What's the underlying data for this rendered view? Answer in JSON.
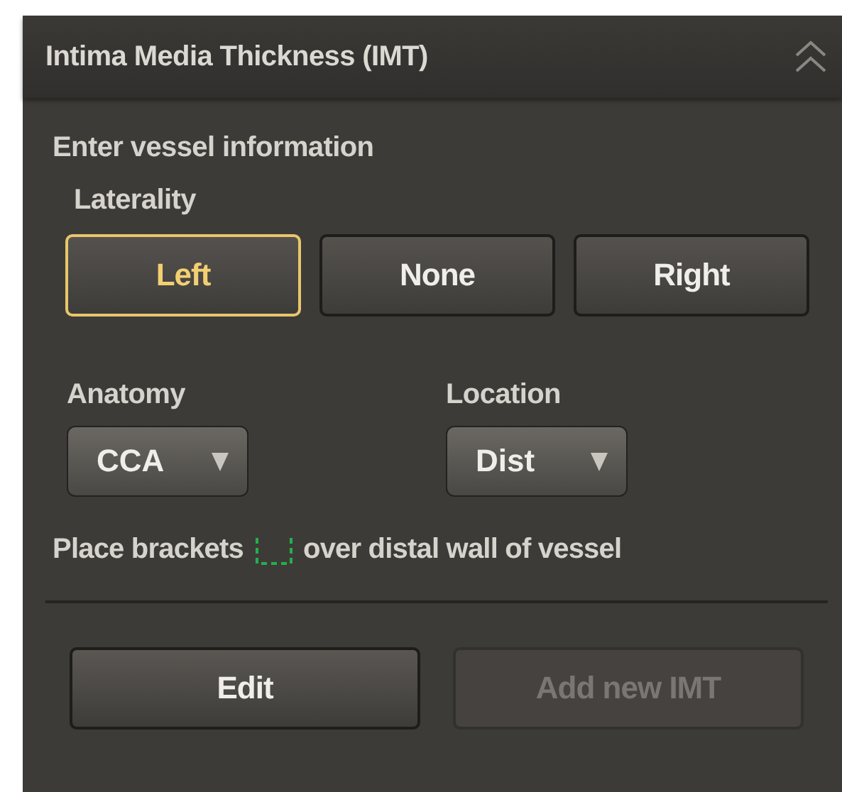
{
  "panel": {
    "title": "Intima Media Thickness (IMT)",
    "expanded": true
  },
  "section_title": "Enter vessel information",
  "laterality": {
    "label": "Laterality",
    "options": [
      {
        "label": "Left",
        "selected": true
      },
      {
        "label": "None",
        "selected": false
      },
      {
        "label": "Right",
        "selected": false
      }
    ]
  },
  "dropdowns": [
    {
      "label": "Anatomy",
      "value": "CCA"
    },
    {
      "label": "Location",
      "value": "Dist"
    }
  ],
  "instruction": {
    "before": "Place brackets",
    "after": "over distal wall of vessel"
  },
  "buttons": [
    {
      "label": "Edit",
      "disabled": false
    },
    {
      "label": "Add new IMT",
      "disabled": true
    }
  ]
}
